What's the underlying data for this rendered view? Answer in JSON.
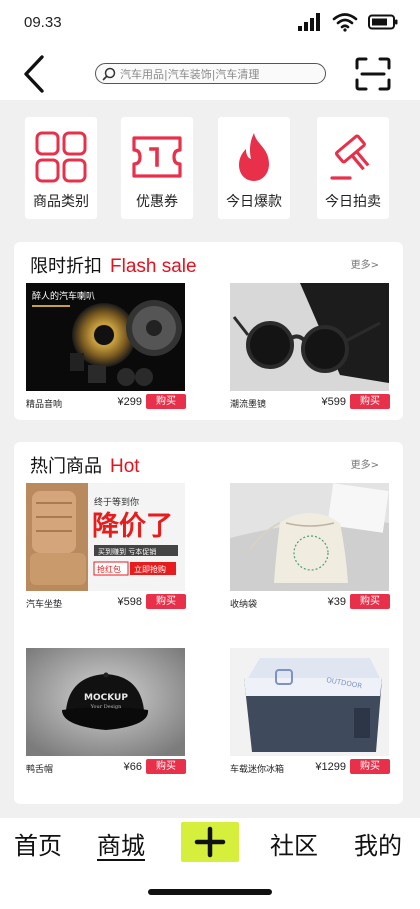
{
  "status": {
    "time": "09.33"
  },
  "search": {
    "placeholder": "汽车用品|汽车装饰|汽车清理"
  },
  "quick_menu": [
    {
      "label": "商品类别",
      "icon": "grid-icon"
    },
    {
      "label": "优惠券",
      "icon": "ticket-icon"
    },
    {
      "label": "今日爆款",
      "icon": "flame-icon"
    },
    {
      "label": "今日拍卖",
      "icon": "gavel-icon"
    }
  ],
  "flash_sale": {
    "title_cn": "限时折扣",
    "title_en": "Flash sale",
    "more": "更多>",
    "banner_text": "醉人的汽车喇叭",
    "items": [
      {
        "name": "精品音响",
        "price": "¥299",
        "buy": "购买"
      },
      {
        "name": "潮流墨镜",
        "price": "¥599",
        "buy": "购买"
      }
    ]
  },
  "hot": {
    "title_cn": "热门商品",
    "title_en": "Hot",
    "more": "更多>",
    "promo": {
      "line1": "终于等到你",
      "big": "降价了",
      "line2": "买到赚到 亏本促销",
      "btn1": "抢红包",
      "btn2": "立即抢购"
    },
    "cap_text": "MOCKUP",
    "cap_sub": "Your Design",
    "cooler_text": "OUTDOOR",
    "items": [
      {
        "name": "汽车坐垫",
        "price": "¥598",
        "buy": "购买"
      },
      {
        "name": "收纳袋",
        "price": "¥39",
        "buy": "购买"
      },
      {
        "name": "鸭舌帽",
        "price": "¥66",
        "buy": "购买"
      },
      {
        "name": "车载迷你冰箱",
        "price": "¥1299",
        "buy": "购买"
      }
    ]
  },
  "nav": {
    "home": "首页",
    "mall": "商城",
    "community": "社区",
    "mine": "我的"
  },
  "colors": {
    "accent": "#e8304a",
    "title_red": "#e8101e",
    "plus_bg": "#d6ee3c",
    "page_bg": "#f0f0f0"
  }
}
